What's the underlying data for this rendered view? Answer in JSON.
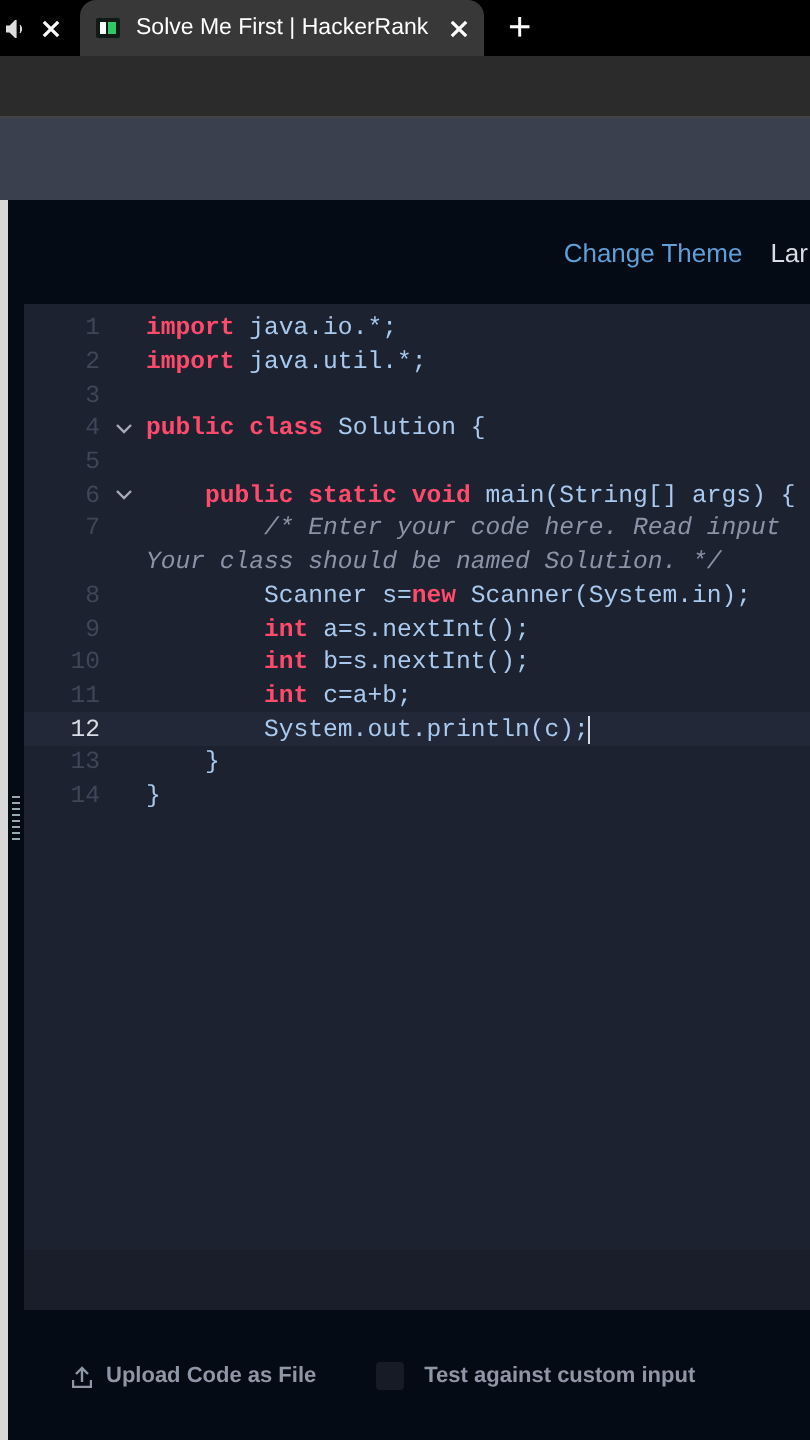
{
  "browser": {
    "tabs": [
      {
        "kind": "audio",
        "selected": false
      },
      {
        "kind": "page",
        "title": "Solve Me First | HackerRank",
        "selected": true
      }
    ],
    "new_tab": "+"
  },
  "toolbar": {
    "links": [
      "Change Theme",
      "Lar"
    ]
  },
  "editor": {
    "rows": [
      {
        "number": "1",
        "fold": false,
        "current": false,
        "tokens": [
          {
            "kind": "keyword",
            "text": "import"
          },
          {
            "kind": "plain",
            "text": " java.io.*;"
          }
        ]
      },
      {
        "number": "2",
        "fold": false,
        "current": false,
        "tokens": [
          {
            "kind": "keyword",
            "text": "import"
          },
          {
            "kind": "plain",
            "text": " java.util.*;"
          }
        ]
      },
      {
        "number": "3",
        "fold": false,
        "current": false,
        "tokens": []
      },
      {
        "number": "4",
        "fold": true,
        "current": false,
        "tokens": [
          {
            "kind": "keyword",
            "text": "public class"
          },
          {
            "kind": "plain",
            "text": " Solution {"
          }
        ]
      },
      {
        "number": "5",
        "fold": false,
        "current": false,
        "tokens": []
      },
      {
        "number": "6",
        "fold": true,
        "current": false,
        "tokens": [
          {
            "kind": "keyword",
            "text": "    public static void"
          },
          {
            "kind": "plain",
            "text": " main(String[] args) {"
          }
        ]
      },
      {
        "number": "7",
        "fold": false,
        "current": false,
        "tokens": [
          {
            "kind": "comment",
            "text": "        /* Enter your code here. Read input"
          }
        ],
        "continuation": [
          {
            "kind": "comment",
            "text": "Your class should be named Solution. */"
          }
        ]
      },
      {
        "number": "8",
        "fold": false,
        "current": false,
        "tokens": [
          {
            "kind": "plain",
            "text": "        Scanner s="
          },
          {
            "kind": "keyword",
            "text": "new"
          },
          {
            "kind": "plain",
            "text": " Scanner(System.in);"
          }
        ]
      },
      {
        "number": "9",
        "fold": false,
        "current": false,
        "tokens": [
          {
            "kind": "keyword",
            "text": "        int"
          },
          {
            "kind": "plain",
            "text": " a=s.nextInt();"
          }
        ]
      },
      {
        "number": "10",
        "fold": false,
        "current": false,
        "tokens": [
          {
            "kind": "keyword",
            "text": "        int"
          },
          {
            "kind": "plain",
            "text": " b=s.nextInt();"
          }
        ]
      },
      {
        "number": "11",
        "fold": false,
        "current": false,
        "tokens": [
          {
            "kind": "keyword",
            "text": "        int"
          },
          {
            "kind": "plain",
            "text": " c=a+b;"
          }
        ]
      },
      {
        "number": "12",
        "fold": false,
        "current": true,
        "tokens": [
          {
            "kind": "plain",
            "text": "        System.out.println(c);"
          }
        ]
      },
      {
        "number": "13",
        "fold": false,
        "current": false,
        "tokens": [
          {
            "kind": "plain",
            "text": "    }"
          }
        ]
      },
      {
        "number": "14",
        "fold": false,
        "current": false,
        "tokens": [
          {
            "kind": "plain",
            "text": "}"
          }
        ]
      }
    ]
  },
  "footer": {
    "upload": "Upload Code as File",
    "custom_input": {
      "label": "Test against custom input",
      "checked": false
    }
  }
}
